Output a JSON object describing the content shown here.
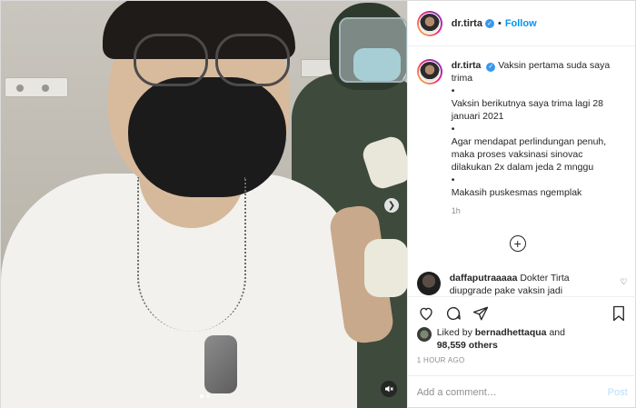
{
  "header": {
    "username": "dr.tirta",
    "separator": "•",
    "follow_label": "Follow"
  },
  "caption": {
    "username": "dr.tirta",
    "lines": [
      "Vaksin pertama suda saya trima",
      "•",
      "Vaksin berikutnya saya trima lagi 28 januari 2021",
      "•",
      "Agar mendapat perlindungan penuh, maka proses vaksinasi sinovac dilakukan 2x dalam jeda 2 mnggu",
      "•",
      "Makasih puskesmas ngemplak"
    ],
    "time": "1h"
  },
  "comment": {
    "username": "daffaputraaaaa",
    "text": "Dokter Tirta diupgrade pake vaksin jadi"
  },
  "likes": {
    "prefix": "Liked by",
    "user": "bernadhettaqua",
    "conj": "and",
    "others": "98,559 others"
  },
  "posted_ago": "1 HOUR AGO",
  "add_comment": {
    "placeholder": "Add a comment…",
    "post_label": "Post"
  },
  "media": {
    "slide_count": 2,
    "active_slide": 1
  },
  "colors": {
    "accent": "#0095f6",
    "verified": "#3897f0",
    "muted": "#8e8e8e",
    "post_disabled": "#b2dffc"
  },
  "icons": [
    "verified-badge-icon",
    "plus-circle-icon",
    "heart-icon",
    "comment-icon",
    "share-icon",
    "bookmark-icon",
    "next-arrow-icon",
    "mute-icon",
    "small-heart-icon"
  ]
}
